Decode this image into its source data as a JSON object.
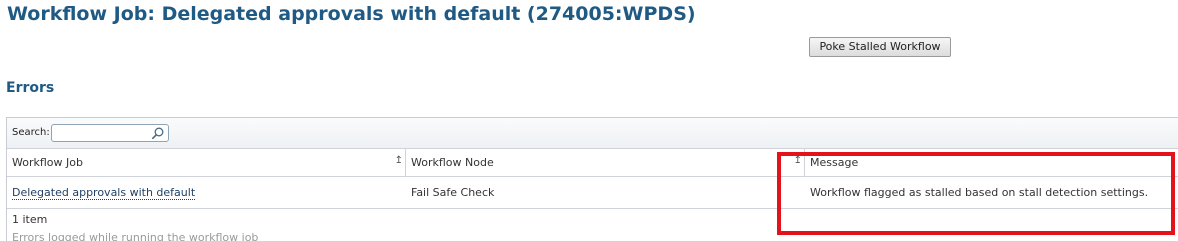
{
  "header": {
    "title": "Workflow Job: Delegated approvals with default (274005:WPDS)"
  },
  "actions": {
    "poke_label": "Poke Stalled Workflow"
  },
  "errors_section": {
    "title": "Errors"
  },
  "grid": {
    "search": {
      "label": "Search:",
      "value": "",
      "icon": "search-icon"
    },
    "columns": [
      {
        "label": "Workflow Job"
      },
      {
        "label": "Workflow Node"
      },
      {
        "label": "Message"
      }
    ],
    "rows": [
      {
        "workflow_job": "Delegated approvals with default",
        "workflow_node": "Fail Safe Check",
        "message": "Workflow flagged as stalled based on stall detection settings."
      }
    ],
    "item_count": "1 item",
    "description": "Errors logged while running the workflow job"
  },
  "annotation": {
    "highlight_color": "#e3121b"
  },
  "colors": {
    "title_blue": "#1f5a85",
    "link": "#1f3f66"
  }
}
